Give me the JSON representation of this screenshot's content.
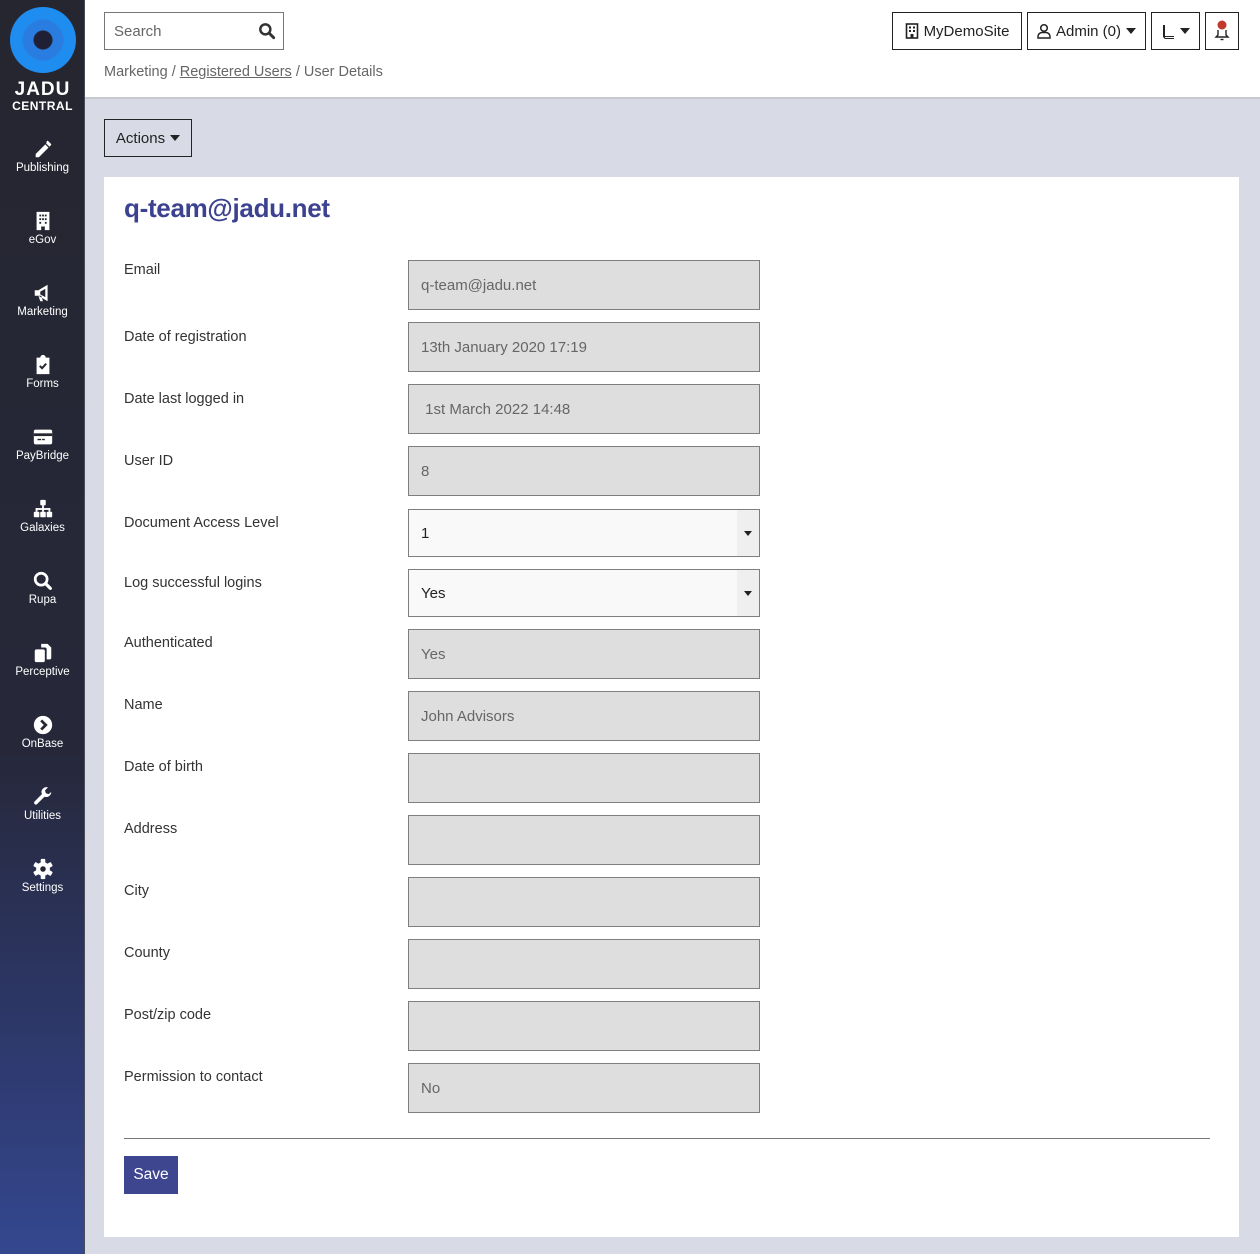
{
  "sidebar": {
    "logo": {
      "line1": "JADU",
      "line2": "CENTRAL"
    },
    "items": [
      {
        "label": "Publishing",
        "icon": "pencil-icon"
      },
      {
        "label": "eGov",
        "icon": "building-icon"
      },
      {
        "label": "Marketing",
        "icon": "megaphone-icon"
      },
      {
        "label": "Forms",
        "icon": "clipboard-check-icon"
      },
      {
        "label": "PayBridge",
        "icon": "credit-card-icon"
      },
      {
        "label": "Galaxies",
        "icon": "sitemap-icon"
      },
      {
        "label": "Rupa",
        "icon": "search-icon"
      },
      {
        "label": "Perceptive",
        "icon": "copy-icon"
      },
      {
        "label": "OnBase",
        "icon": "chevron-circle-right-icon"
      },
      {
        "label": "Utilities",
        "icon": "wrench-icon"
      },
      {
        "label": "Settings",
        "icon": "gear-icon"
      }
    ]
  },
  "header": {
    "search": {
      "placeholder": "Search",
      "value": ""
    },
    "breadcrumb": [
      {
        "label": "Marketing",
        "link": false
      },
      {
        "label": "Registered Users",
        "link": true
      },
      {
        "label": "User Details",
        "link": false
      }
    ],
    "separator": "/",
    "site_button": "MyDemoSite",
    "user_button": "Admin (0)",
    "notification_dot_color": "#c0392b"
  },
  "actions_label": "Actions",
  "page_title": "q-team@jadu.net",
  "form": {
    "fields": [
      {
        "label": "Email",
        "value": "q-team@jadu.net",
        "type": "readonly"
      },
      {
        "label": "Date of registration",
        "value": "13th January 2020 17:19",
        "type": "readonly"
      },
      {
        "label": "Date last logged in",
        "value": " 1st March 2022 14:48",
        "type": "readonly"
      },
      {
        "label": "User ID",
        "value": "8",
        "type": "readonly"
      },
      {
        "label": "Document Access Level",
        "value": "1",
        "type": "select"
      },
      {
        "label": "Log successful logins",
        "value": "Yes",
        "type": "select"
      },
      {
        "label": "Authenticated",
        "value": "Yes",
        "type": "readonly"
      },
      {
        "label": "Name",
        "value": "John Advisors",
        "type": "readonly"
      },
      {
        "label": "Date of birth",
        "value": "",
        "type": "readonly"
      },
      {
        "label": "Address",
        "value": "",
        "type": "readonly"
      },
      {
        "label": "City",
        "value": "",
        "type": "readonly"
      },
      {
        "label": "County",
        "value": "",
        "type": "readonly"
      },
      {
        "label": "Post/zip code",
        "value": "",
        "type": "readonly"
      },
      {
        "label": "Permission to contact",
        "value": "No",
        "type": "readonly"
      }
    ],
    "save_label": "Save"
  },
  "colors": {
    "accent": "#3d4290",
    "save_button": "#3f4690",
    "content_bg": "#d8dae6",
    "readonly_field_bg": "#dedede"
  }
}
